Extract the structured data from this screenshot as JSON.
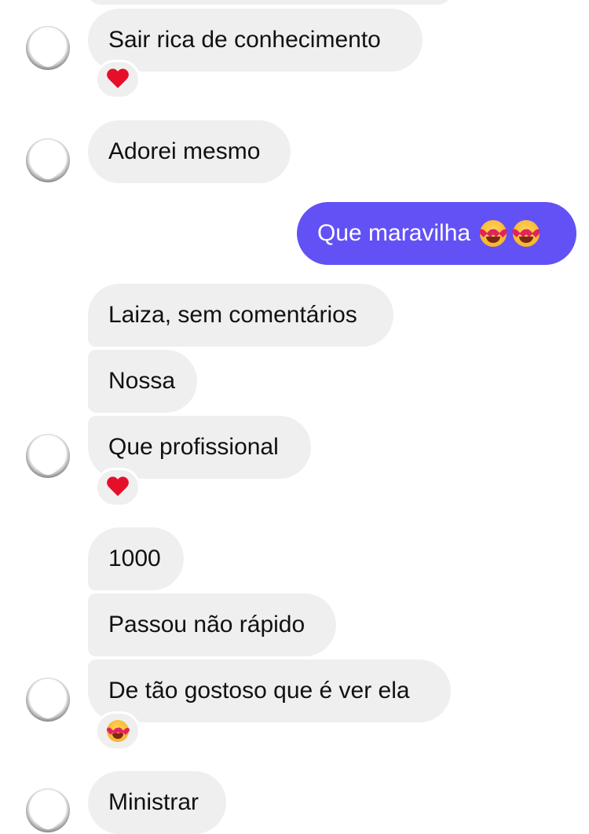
{
  "messages": [
    {
      "text": "Sair rica de conhecimento",
      "sender": "other",
      "reaction": "heart-icon"
    },
    {
      "text": "Adorei mesmo",
      "sender": "other"
    },
    {
      "text": "Que maravilha",
      "sender": "me",
      "emojis": [
        "heart-eyes-emoji",
        "heart-eyes-emoji"
      ]
    },
    {
      "text": "Laiza, sem comentários",
      "sender": "other"
    },
    {
      "text": "Nossa",
      "sender": "other"
    },
    {
      "text": "Que profissional",
      "sender": "other",
      "reaction": "heart-icon"
    },
    {
      "text": "1000",
      "sender": "other"
    },
    {
      "text": "Passou não rápido",
      "sender": "other"
    },
    {
      "text": "De tão gostoso que é ver ela",
      "sender": "other",
      "reaction": "heart-eyes-emoji"
    },
    {
      "text": "Ministrar",
      "sender": "other"
    }
  ],
  "colors": {
    "received_bubble": "#efefef",
    "sent_bubble": "#6251f5",
    "received_text": "#111111",
    "sent_text": "#ffffff",
    "heart": "#e60f2a"
  }
}
